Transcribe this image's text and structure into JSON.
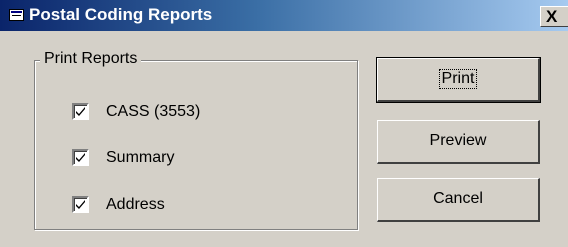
{
  "window": {
    "title": "Postal Coding Reports",
    "close_glyph": "X",
    "title_icon": "form-icon"
  },
  "group": {
    "legend": "Print Reports",
    "items": [
      {
        "label": "CASS (3553)",
        "checked": true
      },
      {
        "label": "Summary",
        "checked": true
      },
      {
        "label": "Address",
        "checked": true
      }
    ]
  },
  "buttons": {
    "print": "Print",
    "preview": "Preview",
    "cancel": "Cancel"
  },
  "colors": {
    "titlebar_start": "#0a246a",
    "titlebar_end": "#a6caf0",
    "face": "#d4d0c8"
  }
}
